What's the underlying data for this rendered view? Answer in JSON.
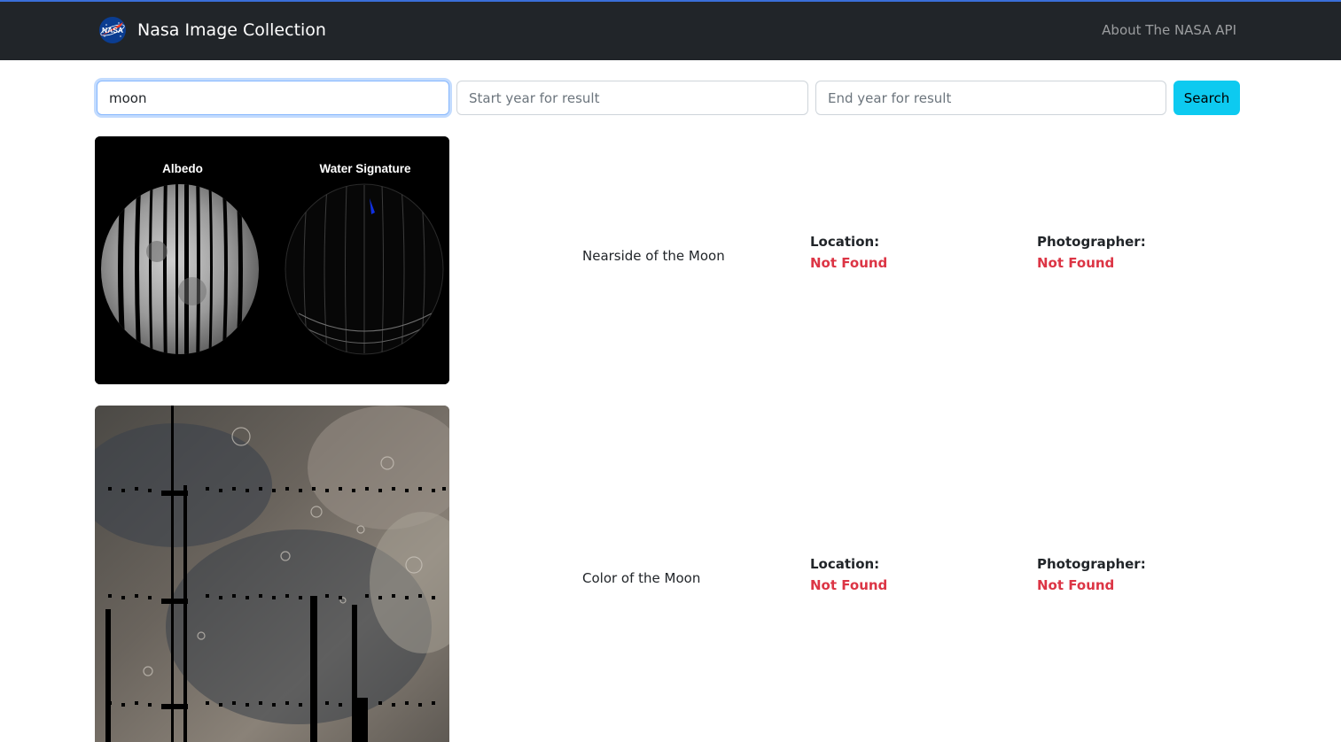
{
  "navbar": {
    "brand": "Nasa Image Collection",
    "logo_icon": "nasa-meatball-logo",
    "about_link": "About The NASA API"
  },
  "search": {
    "query_value": "moon",
    "start_placeholder": "Start year for result",
    "end_placeholder": "End year for result",
    "button_label": "Search"
  },
  "results": [
    {
      "title": "Nearside of the Moon",
      "image_labels": [
        "Albedo",
        "Water Signature"
      ],
      "location_label": "Location:",
      "location_value": "Not Found",
      "photographer_label": "Photographer:",
      "photographer_value": "Not Found"
    },
    {
      "title": "Color of the Moon",
      "location_label": "Location:",
      "location_value": "Not Found",
      "photographer_label": "Photographer:",
      "photographer_value": "Not Found"
    }
  ],
  "colors": {
    "navbar_bg": "#212529",
    "accent_line": "#3a6fd8",
    "search_button": "#0dcaf0",
    "not_found": "#dc3545"
  }
}
